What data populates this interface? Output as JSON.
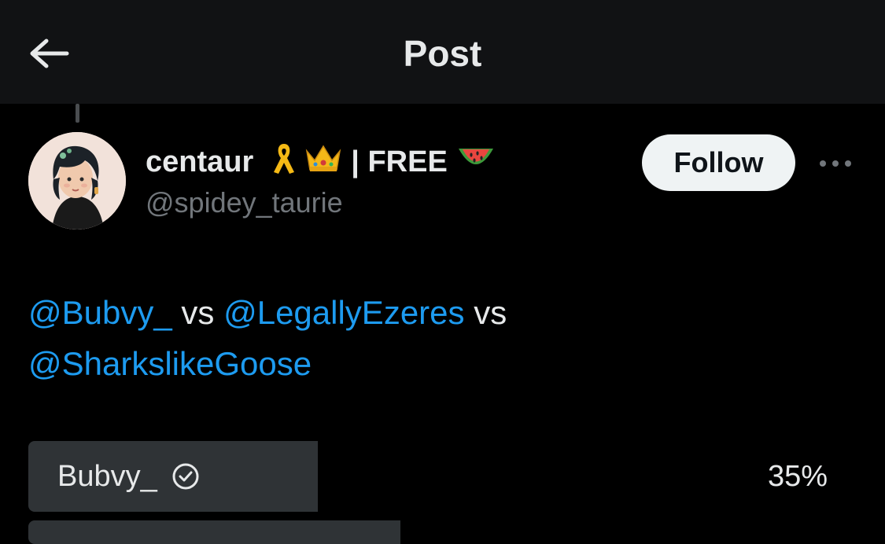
{
  "header": {
    "title": "Post",
    "back_icon": "arrow-left-icon"
  },
  "post": {
    "display_name": "centaur",
    "display_name_suffix": "| FREE",
    "emojis": [
      "yellow-ribbon",
      "crown",
      "watermelon"
    ],
    "handle": "@spidey_taurie",
    "follow_label": "Follow",
    "more_icon": "ellipsis-icon",
    "text": {
      "mention_1": "@Bubvy_",
      "sep_1": " vs ",
      "mention_2": "@LegallyEzeres",
      "sep_2": " vs",
      "mention_3": "@SharkslikeGoose"
    }
  },
  "poll": {
    "options": [
      {
        "label": "Bubvy_",
        "percent_text": "35%",
        "fraction": 0.35,
        "winner_icon": "check-circle-icon"
      },
      {
        "label": "",
        "percent_text": "",
        "fraction": 0.45
      }
    ]
  },
  "colors": {
    "background": "#000000",
    "header_bg": "#111214",
    "mention": "#1d9bf0",
    "secondary_text": "#71767b",
    "poll_bar": "#2f3336",
    "follow_bg": "#eff3f4"
  }
}
